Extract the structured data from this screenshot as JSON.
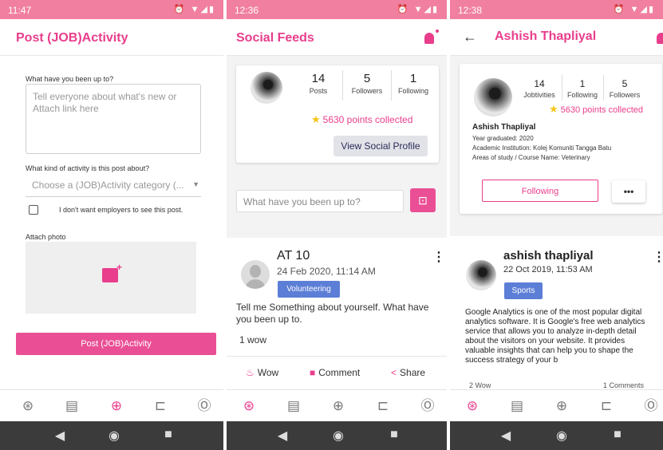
{
  "screen1": {
    "status_time": "11:47",
    "title": "Post (JOB)Activity",
    "q1_label": "What have you been up to?",
    "q1_placeholder": "Tell everyone about what's new or Attach link here",
    "q2_label": "What kind of activity is this post about?",
    "category_placeholder": "Choose a (JOB)Activity category (...",
    "checkbox_label": "I don't want employers to see this post.",
    "attach_label": "Attach photo",
    "submit_label": "Post (JOB)Activity"
  },
  "screen2": {
    "status_time": "12:36",
    "title": "Social Feeds",
    "stats": [
      {
        "value": "14",
        "label": "Posts"
      },
      {
        "value": "5",
        "label": "Followers"
      },
      {
        "value": "1",
        "label": "Following"
      }
    ],
    "points": "5630 points collected",
    "view_profile": "View Social Profile",
    "input_placeholder": "What have you been up to?",
    "post": {
      "author": "AT 10",
      "time": "24 Feb 2020, 11:14 AM",
      "tag": "Volunteering",
      "body": "Tell me Something about yourself. What have you been up to.",
      "wow_count": "1 wow"
    },
    "actions": {
      "wow": "Wow",
      "comment": "Comment",
      "share": "Share"
    }
  },
  "screen3": {
    "status_time": "12:38",
    "title": "Ashish Thapliyal",
    "stats": [
      {
        "value": "14",
        "label": "Jobtivities"
      },
      {
        "value": "1",
        "label": "Following"
      },
      {
        "value": "5",
        "label": "Followers"
      }
    ],
    "points": "5630 points collected",
    "name": "Ashish Thapliyal",
    "year": "Year graduated: 2020",
    "institution": "Academic Institution: Kolej Komuniti Tangga Batu",
    "study": "Areas of study / Course Name: Veterinary",
    "following_btn": "Following",
    "more_btn": "•••",
    "post": {
      "author": "ashish thapliyal",
      "time": "22 Oct 2019, 11:53 AM",
      "tag": "Sports",
      "body": "Google Analytics is one of the most popular digital analytics software. It is Google's free web analytics service that allows you to analyze in-depth detail about the visitors on your website. It provides valuable insights that can help you to shape the success strategy of your b",
      "wow": "2 Wow",
      "comments": "1 Comments"
    }
  },
  "colors": {
    "accent": "#e83e8c",
    "status_bar": "#f17fa0",
    "tag": "#5c7ed6"
  },
  "icons": {
    "status": "alarm-wifi-signal-battery-icons",
    "nav": [
      "dashboard-icon",
      "document-icon",
      "add-circle-icon",
      "briefcase-icon",
      "profile-icon"
    ]
  }
}
